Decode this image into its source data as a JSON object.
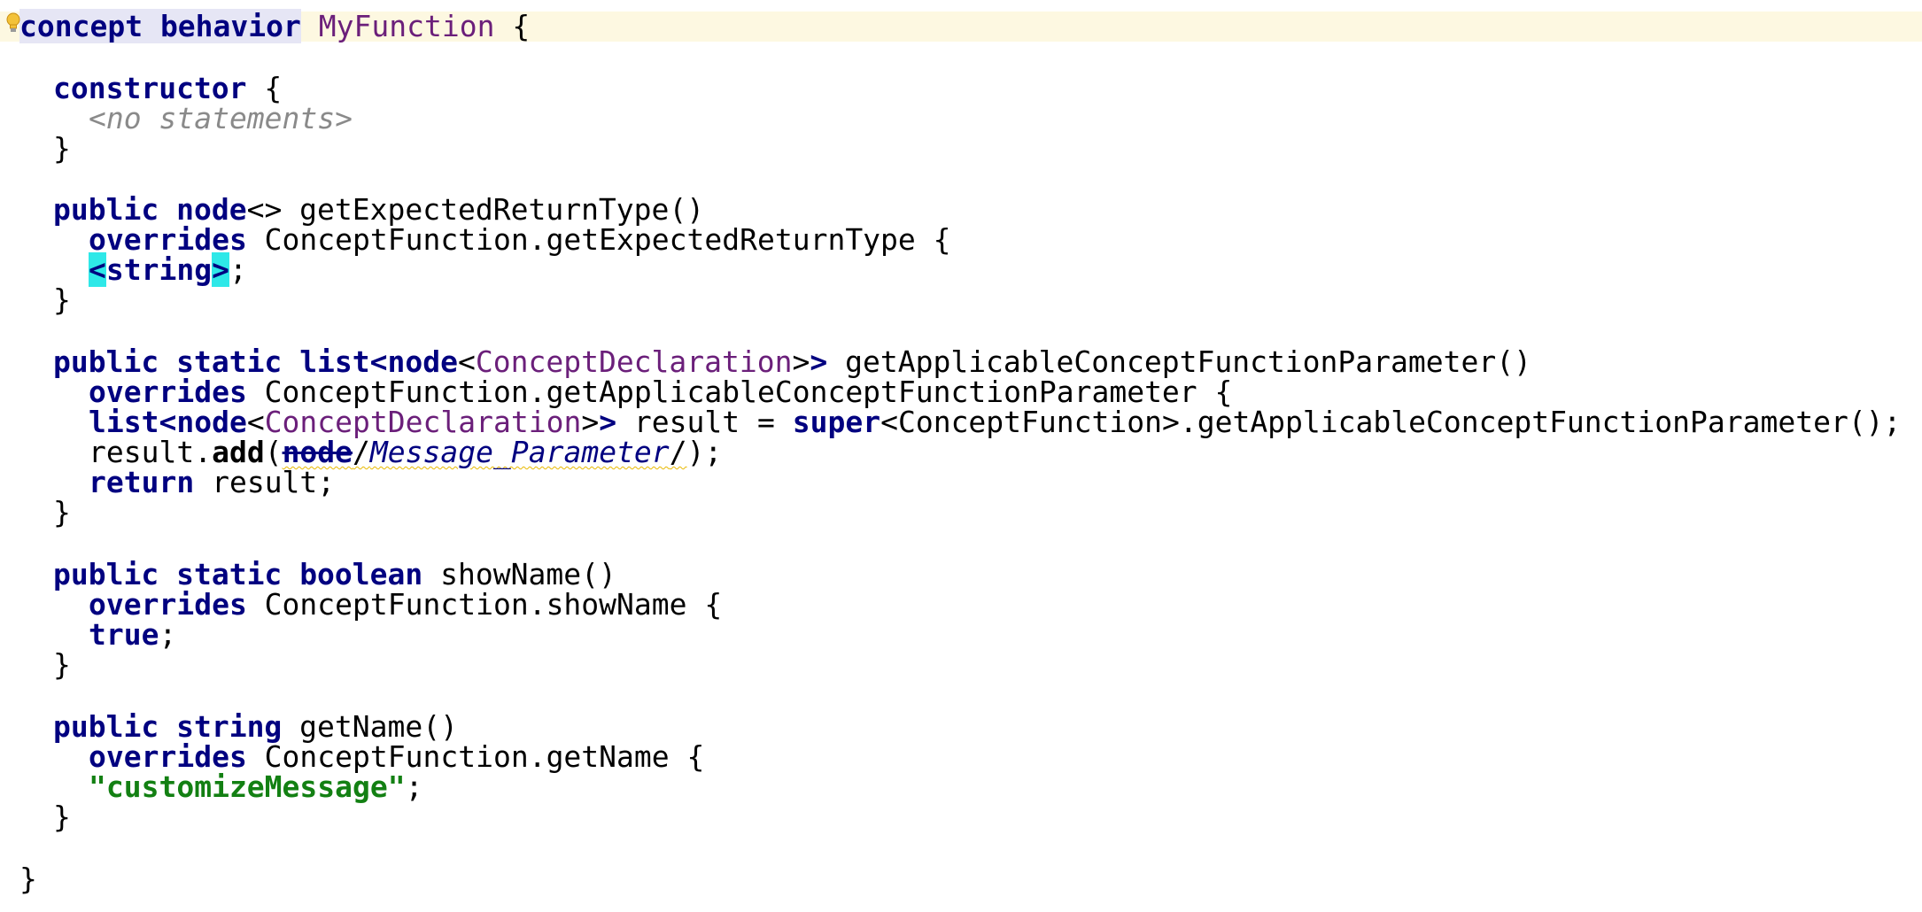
{
  "editor": {
    "lines": {
      "l1": {
        "kw1": "concept behavior",
        "concept": "MyFunction",
        "brace": " {"
      },
      "l3": {
        "kw": "constructor",
        "brace": " {"
      },
      "l4": {
        "comment": "<no statements>"
      },
      "l5": {
        "close": "}"
      },
      "l7": {
        "kw1": "public",
        "sp1": " ",
        "kw2": "node",
        "rest": "<> getExpectedReturnType()"
      },
      "l8": {
        "kw": "overrides",
        "rest": " ConceptFunction.getExpectedReturnType {"
      },
      "l9": {
        "lt": "<",
        "kw": "string",
        "gt": ">",
        "semi": ";"
      },
      "l10": {
        "close": "}"
      },
      "l12": {
        "kw1": "public",
        "kw2": "static",
        "kw3": "list<node",
        "lt": "<",
        "concept": "ConceptDeclaration",
        "gt": ">",
        "kwgt": ">",
        "rest": " getApplicableConceptFunctionParameter()"
      },
      "l13": {
        "kw": "overrides",
        "rest": " ConceptFunction.getApplicableConceptFunctionParameter {"
      },
      "l14": {
        "kw1": "list<node",
        "lt": "<",
        "concept": "ConceptDeclaration",
        "gt": ">",
        "kwgt": ">",
        "mid": " result = ",
        "kw2": "super",
        "rest": "<ConceptFunction>.getApplicableConceptFunctionParameter();"
      },
      "l15": {
        "pre": "result.",
        "method": "add",
        "paren": "(",
        "strike": "node",
        "slash1": "/",
        "ref": "Message_Parameter",
        "slash2": "/",
        "close": ");"
      },
      "l16": {
        "kw": "return",
        "rest": " result;"
      },
      "l17": {
        "close": "}"
      },
      "l19": {
        "kw1": "public",
        "kw2": "static",
        "kw3": "boolean",
        "rest": " showName()"
      },
      "l20": {
        "kw": "overrides",
        "rest": " ConceptFunction.showName {"
      },
      "l21": {
        "kw": "true",
        "semi": ";"
      },
      "l22": {
        "close": "}"
      },
      "l24": {
        "kw1": "public",
        "kw2": "string",
        "rest": " getName()"
      },
      "l25": {
        "kw": "overrides",
        "rest": " ConceptFunction.getName {"
      },
      "l26": {
        "str": "\"customizeMessage\"",
        "semi": ";"
      },
      "l27": {
        "close": "}"
      },
      "l29": {
        "close": "}"
      }
    },
    "icons": {
      "intention": "lightbulb-icon"
    },
    "colors": {
      "keyword": "#000080",
      "concept_ref": "#6b1f7a",
      "comment": "#8a8a8a",
      "string": "#138013",
      "current_line": "#fdf8e1",
      "bracket_highlight": "#2ee8e8",
      "error_squiggle": "#e8b800"
    }
  }
}
